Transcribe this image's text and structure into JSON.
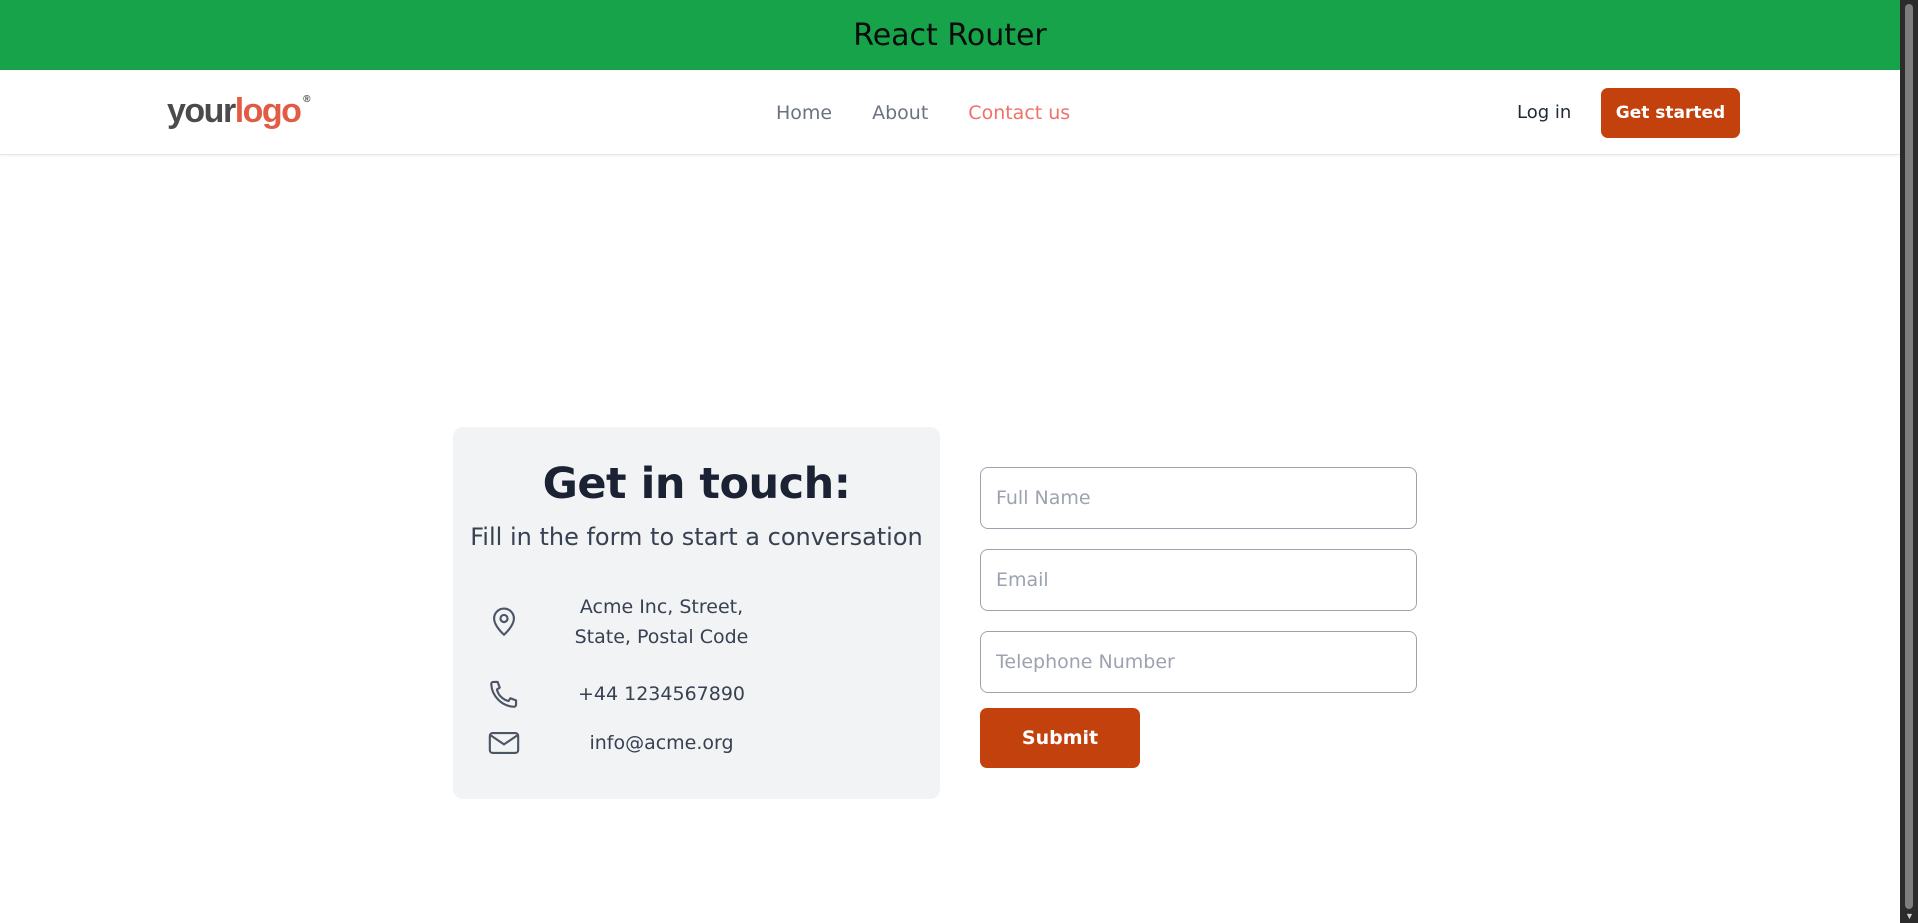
{
  "banner": {
    "title": "React Router"
  },
  "logo": {
    "part1": "your",
    "part2": "logo",
    "mark": "®"
  },
  "nav": {
    "items": [
      {
        "label": "Home",
        "active": false
      },
      {
        "label": "About",
        "active": false
      },
      {
        "label": "Contact us",
        "active": true
      }
    ],
    "login_label": "Log in",
    "cta_label": "Get started"
  },
  "contact": {
    "heading": "Get in touch:",
    "subheading": "Fill in the form to start a conversation",
    "address_line1": "Acme Inc, Street,",
    "address_line2": "State, Postal Code",
    "phone": "+44 1234567890",
    "email": "info@acme.org",
    "icons": [
      "map-pin-icon",
      "phone-icon",
      "mail-icon"
    ]
  },
  "form": {
    "full_name": {
      "placeholder": "Full Name",
      "value": ""
    },
    "email": {
      "placeholder": "Email",
      "value": ""
    },
    "telephone": {
      "placeholder": "Telephone Number",
      "value": ""
    },
    "submit_label": "Submit"
  },
  "colors": {
    "banner": "#17a34a",
    "accent": "#c2410c",
    "active_link": "#f07167",
    "card_bg": "#f2f3f5"
  }
}
